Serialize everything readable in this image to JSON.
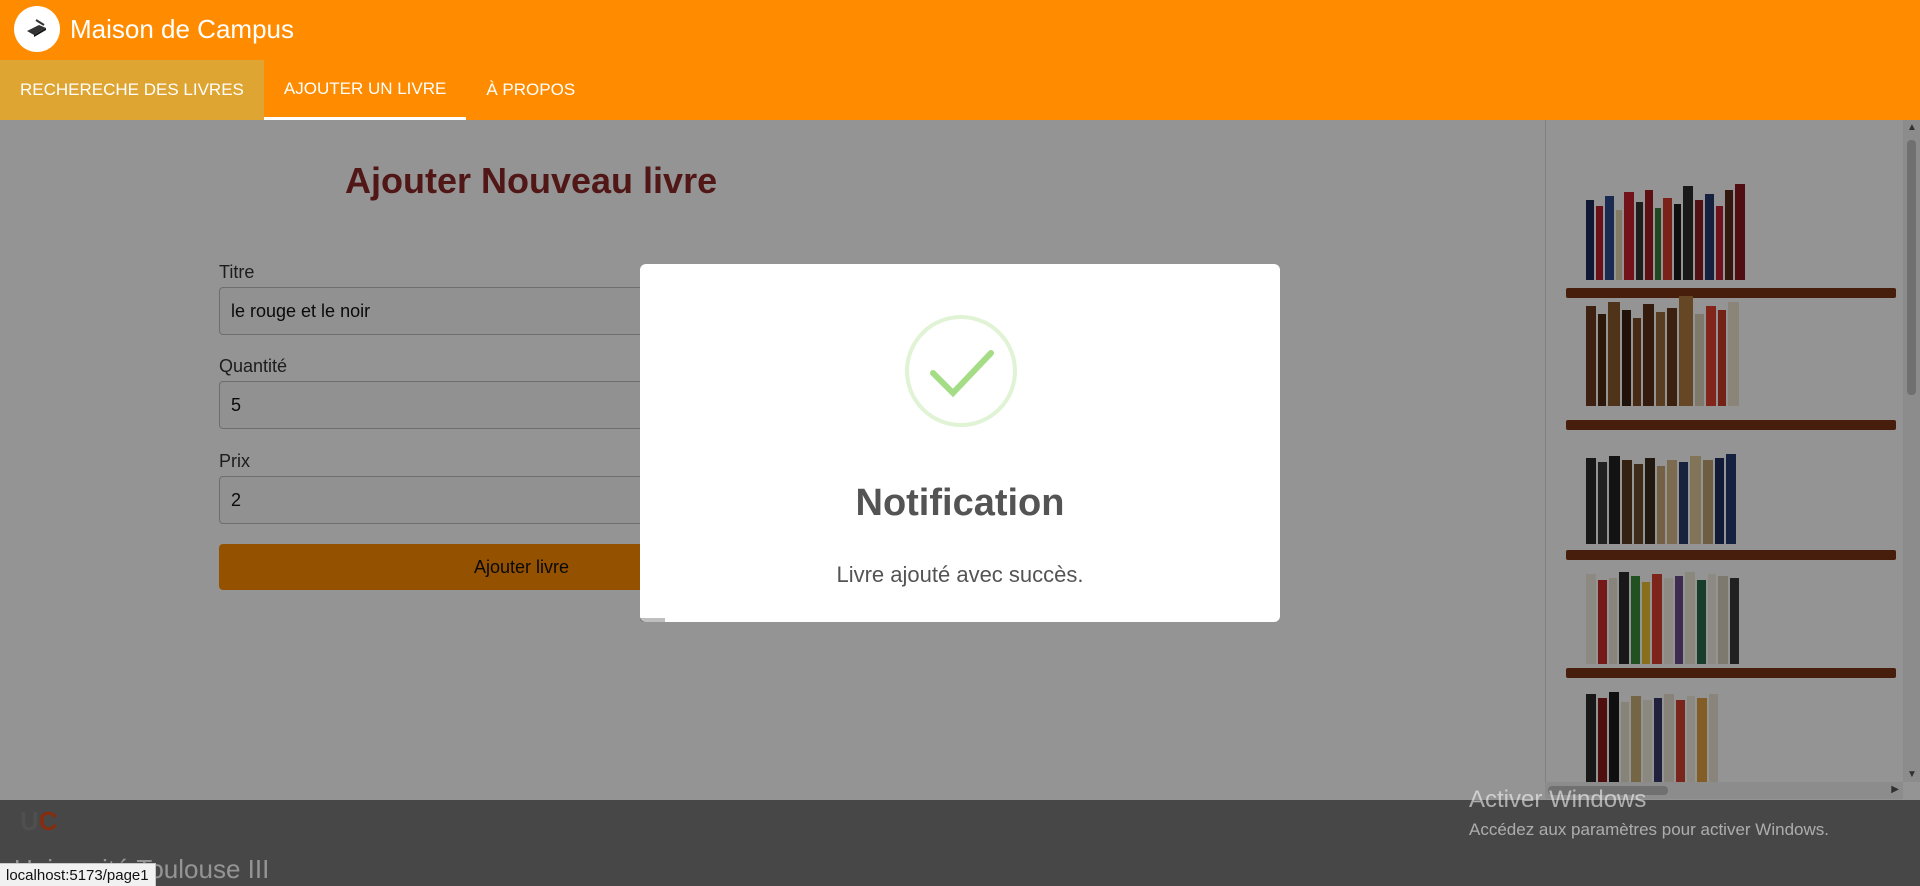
{
  "app": {
    "title": "Maison de Campus",
    "brand_color": "#ff8c00"
  },
  "nav": {
    "tabs": [
      {
        "label": "RECHERECHE DES LIVRES"
      },
      {
        "label": "AJOUTER UN LIVRE",
        "active": true
      },
      {
        "label": "À PROPOS"
      }
    ]
  },
  "form": {
    "title": "Ajouter Nouveau livre",
    "fields": [
      {
        "label": "Titre",
        "value": "le rouge et le noir"
      },
      {
        "label": "Quantité",
        "value": "5"
      },
      {
        "label": "Prix",
        "value": "2"
      }
    ],
    "submit_label": "Ajouter livre"
  },
  "dialog": {
    "icon": "success-check-icon",
    "title": "Notification",
    "message": "Livre ajouté avec succès."
  },
  "footer": {
    "logo_text": "UC",
    "text": "Université Toulouse III"
  },
  "windows_watermark": {
    "title": "Activer Windows",
    "subtitle": "Accédez aux paramètres pour activer Windows."
  },
  "status_url": "localhost:5173/page1"
}
